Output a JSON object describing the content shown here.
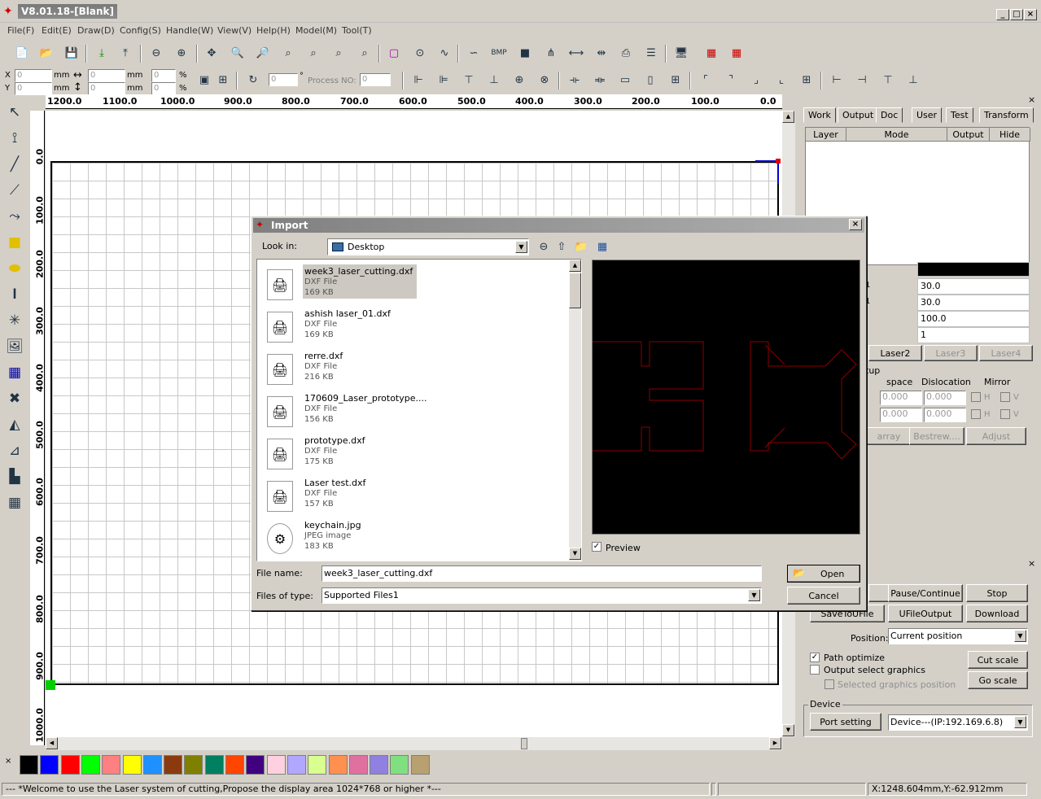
{
  "app": {
    "title": "V8.01.18-[Blank]"
  },
  "menu": [
    "File(F)",
    "Edit(E)",
    "Draw(D)",
    "Config(S)",
    "Handle(W)",
    "View(V)",
    "Help(H)",
    "Model(M)",
    "Tool(T)"
  ],
  "coords": {
    "x_label": "X",
    "y_label": "Y",
    "x_value": "0",
    "y_value": "0",
    "unit": "mm",
    "w_value": "0",
    "h_value": "0",
    "sx": "0",
    "sy": "0",
    "percent": "%",
    "angle": "0",
    "degree": "°",
    "process_label": "Process NO:",
    "process_value": "0"
  },
  "ruler": {
    "h_ticks": [
      "1200.0",
      "1100.0",
      "1000.0",
      "900.0",
      "800.0",
      "700.0",
      "600.0",
      "500.0",
      "400.0",
      "300.0",
      "200.0",
      "100.0",
      "0.0"
    ],
    "v_ticks": [
      "0.0",
      "100.0",
      "200.0",
      "300.0",
      "400.0",
      "500.0",
      "600.0",
      "700.0",
      "800.0",
      "900.0",
      "1000.0"
    ]
  },
  "panel": {
    "tabs": [
      "Work",
      "Output",
      "Doc",
      "User",
      "Test",
      "Transform"
    ],
    "layer_headers": [
      "Layer",
      "Mode",
      "Output",
      "Hide"
    ],
    "param_values": [
      "30.0",
      "30.0",
      "100.0",
      "1"
    ],
    "param_prefix": [
      "1",
      "1"
    ],
    "laser_tabs": [
      "Laser2",
      "Laser3",
      "Laser4"
    ],
    "setup_label": "tup",
    "array_headers": [
      "space",
      "Dislocation",
      "Mirror"
    ],
    "array_values": [
      "0.000",
      "0.000",
      "0.000",
      "0.000"
    ],
    "mirror_h": "H",
    "mirror_v": "V",
    "array_buttons": [
      "array",
      "Bestrew....",
      "Adjust"
    ]
  },
  "output": {
    "buttons": [
      "Pause/Continue",
      "Stop",
      "SaveToUFile",
      "UFileOutput",
      "Download"
    ],
    "position_label": "Position:",
    "position_value": "Current position",
    "path_optimize": "Path optimize",
    "output_select": "Output select graphics",
    "selected_pos": "Selected graphics position",
    "cut_scale": "Cut scale",
    "go_scale": "Go scale",
    "device_label": "Device",
    "port_setting": "Port setting",
    "device_value": "Device---(IP:192.169.6.8)"
  },
  "dialog": {
    "title": "Import",
    "look_in_label": "Look in:",
    "look_in_value": "Desktop",
    "files": [
      {
        "name": "week3_laser_cutting.dxf",
        "type": "DXF File",
        "size": "169 KB"
      },
      {
        "name": "ashish laser_01.dxf",
        "type": "DXF File",
        "size": "169 KB"
      },
      {
        "name": "rerre.dxf",
        "type": "DXF File",
        "size": "216 KB"
      },
      {
        "name": "170609_Laser_prototype....",
        "type": "DXF File",
        "size": "156 KB"
      },
      {
        "name": "prototype.dxf",
        "type": "DXF File",
        "size": "175 KB"
      },
      {
        "name": "Laser test.dxf",
        "type": "DXF File",
        "size": "157 KB"
      },
      {
        "name": "keychain.jpg",
        "type": "JPEG image",
        "size": "183 KB"
      }
    ],
    "preview_label": "Preview",
    "file_name_label": "File name:",
    "file_name_value": "week3_laser_cutting.dxf",
    "file_type_label": "Files of type:",
    "file_type_value": "Supported Files1",
    "open_button": "Open",
    "cancel_button": "Cancel"
  },
  "palette": [
    "#000000",
    "#0000ff",
    "#ff0000",
    "#00ff00",
    "#ff8080",
    "#ffff00",
    "#1e90ff",
    "#8b3a0f",
    "#808000",
    "#008060",
    "#ff4500",
    "#400080",
    "#ffd0e0",
    "#b0a8ff",
    "#d8ff90",
    "#ff9050",
    "#e070a0",
    "#9080e0",
    "#80e080",
    "#b8a070"
  ],
  "status": {
    "message": "--- *Welcome to use the Laser system of cutting,Propose the display area 1024*768 or higher *---",
    "coords": "X:1248.604mm,Y:-62.912mm"
  }
}
